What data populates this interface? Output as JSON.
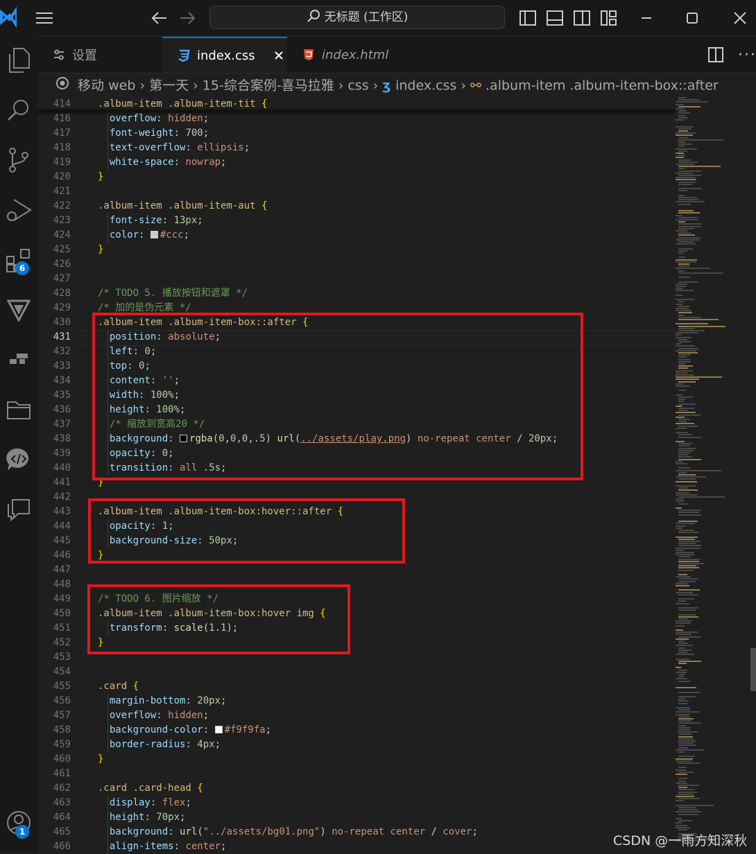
{
  "window": {
    "title": "无标题 (工作区)"
  },
  "tabs": [
    {
      "label": "设置",
      "icon": "settings-sliders-icon"
    },
    {
      "label": "index.css",
      "icon": "css-file-icon",
      "active": true
    },
    {
      "label": "index.html",
      "icon": "html-file-icon"
    }
  ],
  "breadcrumb": [
    "移动 web",
    "第一天",
    "15-综合案例-喜马拉雅",
    "css",
    "index.css",
    ".album-item .album-item-box::after"
  ],
  "activity_badges": {
    "extensions": "6",
    "accounts": "1"
  },
  "colors": {
    "accent": "#0078d4",
    "highlight_box": "#e0191d"
  },
  "lines": [
    {
      "n": "414",
      "t": [
        [
          "sel",
          ".album-item .album-item-tit "
        ],
        [
          "brace",
          "{"
        ]
      ]
    },
    {
      "n": "416",
      "t": [
        [
          "sp",
          "  "
        ],
        [
          "prop",
          "overflow"
        ],
        [
          "punc",
          ": "
        ],
        [
          "val",
          "hidden"
        ],
        [
          "punc",
          ";"
        ]
      ]
    },
    {
      "n": "417",
      "t": [
        [
          "sp",
          "  "
        ],
        [
          "prop",
          "font-weight"
        ],
        [
          "punc",
          ": "
        ],
        [
          "num",
          "700"
        ],
        [
          "punc",
          ";"
        ]
      ]
    },
    {
      "n": "418",
      "t": [
        [
          "sp",
          "  "
        ],
        [
          "prop",
          "text-overflow"
        ],
        [
          "punc",
          ": "
        ],
        [
          "val",
          "ellipsis"
        ],
        [
          "punc",
          ";"
        ]
      ]
    },
    {
      "n": "419",
      "t": [
        [
          "sp",
          "  "
        ],
        [
          "prop",
          "white-space"
        ],
        [
          "punc",
          ": "
        ],
        [
          "val",
          "nowrap"
        ],
        [
          "punc",
          ";"
        ]
      ]
    },
    {
      "n": "420",
      "t": [
        [
          "brace",
          "}"
        ]
      ]
    },
    {
      "n": "421",
      "t": []
    },
    {
      "n": "422",
      "t": [
        [
          "sel",
          ".album-item .album-item-aut "
        ],
        [
          "brace",
          "{"
        ]
      ]
    },
    {
      "n": "423",
      "t": [
        [
          "sp",
          "  "
        ],
        [
          "prop",
          "font-size"
        ],
        [
          "punc",
          ": "
        ],
        [
          "num",
          "13px"
        ],
        [
          "punc",
          ";"
        ]
      ]
    },
    {
      "n": "424",
      "t": [
        [
          "sp",
          "  "
        ],
        [
          "prop",
          "color"
        ],
        [
          "punc",
          ": "
        ],
        [
          "sw",
          "#cccccc"
        ],
        [
          "val",
          "#ccc"
        ],
        [
          "punc",
          ";"
        ]
      ]
    },
    {
      "n": "425",
      "t": [
        [
          "brace",
          "}"
        ]
      ]
    },
    {
      "n": "426",
      "t": []
    },
    {
      "n": "427",
      "t": []
    },
    {
      "n": "428",
      "t": [
        [
          "com",
          "/* TODO 5. 播放按钮和遮罩 */"
        ]
      ]
    },
    {
      "n": "429",
      "t": [
        [
          "com",
          "/* 加的是伪元素 */"
        ]
      ]
    },
    {
      "n": "430",
      "t": [
        [
          "sel",
          ".album-item .album-item-box::after "
        ],
        [
          "brace",
          "{"
        ]
      ]
    },
    {
      "n": "431",
      "t": [
        [
          "sp",
          "  "
        ],
        [
          "prop",
          "position"
        ],
        [
          "punc",
          ": "
        ],
        [
          "val",
          "absolute"
        ],
        [
          "punc",
          ";"
        ]
      ]
    },
    {
      "n": "432",
      "t": [
        [
          "sp",
          "  "
        ],
        [
          "prop",
          "left"
        ],
        [
          "punc",
          ": "
        ],
        [
          "num",
          "0"
        ],
        [
          "punc",
          ";"
        ]
      ]
    },
    {
      "n": "433",
      "t": [
        [
          "sp",
          "  "
        ],
        [
          "prop",
          "top"
        ],
        [
          "punc",
          ": "
        ],
        [
          "num",
          "0"
        ],
        [
          "punc",
          ";"
        ]
      ]
    },
    {
      "n": "434",
      "t": [
        [
          "sp",
          "  "
        ],
        [
          "prop",
          "content"
        ],
        [
          "punc",
          ": "
        ],
        [
          "val",
          "''"
        ],
        [
          "punc",
          ";"
        ]
      ]
    },
    {
      "n": "435",
      "t": [
        [
          "sp",
          "  "
        ],
        [
          "prop",
          "width"
        ],
        [
          "punc",
          ": "
        ],
        [
          "num",
          "100%"
        ],
        [
          "punc",
          ";"
        ]
      ]
    },
    {
      "n": "436",
      "t": [
        [
          "sp",
          "  "
        ],
        [
          "prop",
          "height"
        ],
        [
          "punc",
          ": "
        ],
        [
          "num",
          "100%"
        ],
        [
          "punc",
          ";"
        ]
      ]
    },
    {
      "n": "437",
      "t": [
        [
          "sp",
          "  "
        ],
        [
          "com",
          "/* 缩放到宽高20 */"
        ]
      ]
    },
    {
      "n": "438",
      "t": [
        [
          "sp",
          "  "
        ],
        [
          "prop",
          "background"
        ],
        [
          "punc",
          ": "
        ],
        [
          "sw",
          "#000000"
        ],
        [
          "fn",
          "rgba"
        ],
        [
          "punc",
          "("
        ],
        [
          "num",
          "0"
        ],
        [
          "punc",
          ","
        ],
        [
          "num",
          "0"
        ],
        [
          "punc",
          ","
        ],
        [
          "num",
          "0"
        ],
        [
          "punc",
          ","
        ],
        [
          "num",
          ".5"
        ],
        [
          "punc",
          ") "
        ],
        [
          "fn",
          "url"
        ],
        [
          "punc",
          "("
        ],
        [
          "url",
          "../assets/play.png"
        ],
        [
          "punc",
          ") "
        ],
        [
          "val",
          "no-repeat center"
        ],
        [
          "punc",
          " / "
        ],
        [
          "num",
          "20px"
        ],
        [
          "punc",
          ";"
        ]
      ]
    },
    {
      "n": "439",
      "t": [
        [
          "sp",
          "  "
        ],
        [
          "prop",
          "opacity"
        ],
        [
          "punc",
          ": "
        ],
        [
          "num",
          "0"
        ],
        [
          "punc",
          ";"
        ]
      ]
    },
    {
      "n": "440",
      "t": [
        [
          "sp",
          "  "
        ],
        [
          "prop",
          "transition"
        ],
        [
          "punc",
          ": "
        ],
        [
          "val",
          "all"
        ],
        [
          "punc",
          " "
        ],
        [
          "num",
          ".5s"
        ],
        [
          "punc",
          ";"
        ]
      ]
    },
    {
      "n": "441",
      "t": [
        [
          "brace",
          "}"
        ]
      ]
    },
    {
      "n": "442",
      "t": []
    },
    {
      "n": "443",
      "t": [
        [
          "sel",
          ".album-item .album-item-box:hover::after "
        ],
        [
          "brace",
          "{"
        ]
      ]
    },
    {
      "n": "444",
      "t": [
        [
          "sp",
          "  "
        ],
        [
          "prop",
          "opacity"
        ],
        [
          "punc",
          ": "
        ],
        [
          "num",
          "1"
        ],
        [
          "punc",
          ";"
        ]
      ]
    },
    {
      "n": "445",
      "t": [
        [
          "sp",
          "  "
        ],
        [
          "prop",
          "background-size"
        ],
        [
          "punc",
          ": "
        ],
        [
          "num",
          "50px"
        ],
        [
          "punc",
          ";"
        ]
      ]
    },
    {
      "n": "446",
      "t": [
        [
          "brace",
          "}"
        ]
      ]
    },
    {
      "n": "447",
      "t": []
    },
    {
      "n": "448",
      "t": []
    },
    {
      "n": "449",
      "t": [
        [
          "com",
          "/* TODO 6. 图片缩放 */"
        ]
      ]
    },
    {
      "n": "450",
      "t": [
        [
          "sel",
          ".album-item .album-item-box:hover img "
        ],
        [
          "brace",
          "{"
        ]
      ]
    },
    {
      "n": "451",
      "t": [
        [
          "sp",
          "  "
        ],
        [
          "prop",
          "transform"
        ],
        [
          "punc",
          ": "
        ],
        [
          "fn",
          "scale"
        ],
        [
          "punc",
          "("
        ],
        [
          "num",
          "1.1"
        ],
        [
          "punc",
          ");"
        ]
      ]
    },
    {
      "n": "452",
      "t": [
        [
          "brace",
          "}"
        ]
      ]
    },
    {
      "n": "453",
      "t": []
    },
    {
      "n": "454",
      "t": []
    },
    {
      "n": "455",
      "t": [
        [
          "sel",
          ".card "
        ],
        [
          "brace",
          "{"
        ]
      ]
    },
    {
      "n": "456",
      "t": [
        [
          "sp",
          "  "
        ],
        [
          "prop",
          "margin-bottom"
        ],
        [
          "punc",
          ": "
        ],
        [
          "num",
          "20px"
        ],
        [
          "punc",
          ";"
        ]
      ]
    },
    {
      "n": "457",
      "t": [
        [
          "sp",
          "  "
        ],
        [
          "prop",
          "overflow"
        ],
        [
          "punc",
          ": "
        ],
        [
          "val",
          "hidden"
        ],
        [
          "punc",
          ";"
        ]
      ]
    },
    {
      "n": "458",
      "t": [
        [
          "sp",
          "  "
        ],
        [
          "prop",
          "background-color"
        ],
        [
          "punc",
          ": "
        ],
        [
          "sw",
          "#f9f9fa"
        ],
        [
          "val",
          "#f9f9fa"
        ],
        [
          "punc",
          ";"
        ]
      ]
    },
    {
      "n": "459",
      "t": [
        [
          "sp",
          "  "
        ],
        [
          "prop",
          "border-radius"
        ],
        [
          "punc",
          ": "
        ],
        [
          "num",
          "4px"
        ],
        [
          "punc",
          ";"
        ]
      ]
    },
    {
      "n": "460",
      "t": [
        [
          "brace",
          "}"
        ]
      ]
    },
    {
      "n": "461",
      "t": []
    },
    {
      "n": "462",
      "t": [
        [
          "sel",
          ".card .card-head "
        ],
        [
          "brace",
          "{"
        ]
      ]
    },
    {
      "n": "463",
      "t": [
        [
          "sp",
          "  "
        ],
        [
          "prop",
          "display"
        ],
        [
          "punc",
          ": "
        ],
        [
          "val",
          "flex"
        ],
        [
          "punc",
          ";"
        ]
      ]
    },
    {
      "n": "464",
      "t": [
        [
          "sp",
          "  "
        ],
        [
          "prop",
          "height"
        ],
        [
          "punc",
          ": "
        ],
        [
          "num",
          "70px"
        ],
        [
          "punc",
          ";"
        ]
      ]
    },
    {
      "n": "465",
      "t": [
        [
          "sp",
          "  "
        ],
        [
          "prop",
          "background"
        ],
        [
          "punc",
          ": "
        ],
        [
          "fn",
          "url"
        ],
        [
          "punc",
          "("
        ],
        [
          "val",
          "\"../assets/bg01.png\""
        ],
        [
          "punc",
          ") "
        ],
        [
          "val",
          "no-repeat center"
        ],
        [
          "punc",
          " / "
        ],
        [
          "val",
          "cover"
        ],
        [
          "punc",
          ";"
        ]
      ]
    },
    {
      "n": "466",
      "t": [
        [
          "sp",
          "  "
        ],
        [
          "prop",
          "align-items"
        ],
        [
          "punc",
          ": "
        ],
        [
          "val",
          "center"
        ],
        [
          "punc",
          ";"
        ]
      ]
    }
  ],
  "current_line": "431",
  "watermark": "CSDN @一雨方知深秋"
}
